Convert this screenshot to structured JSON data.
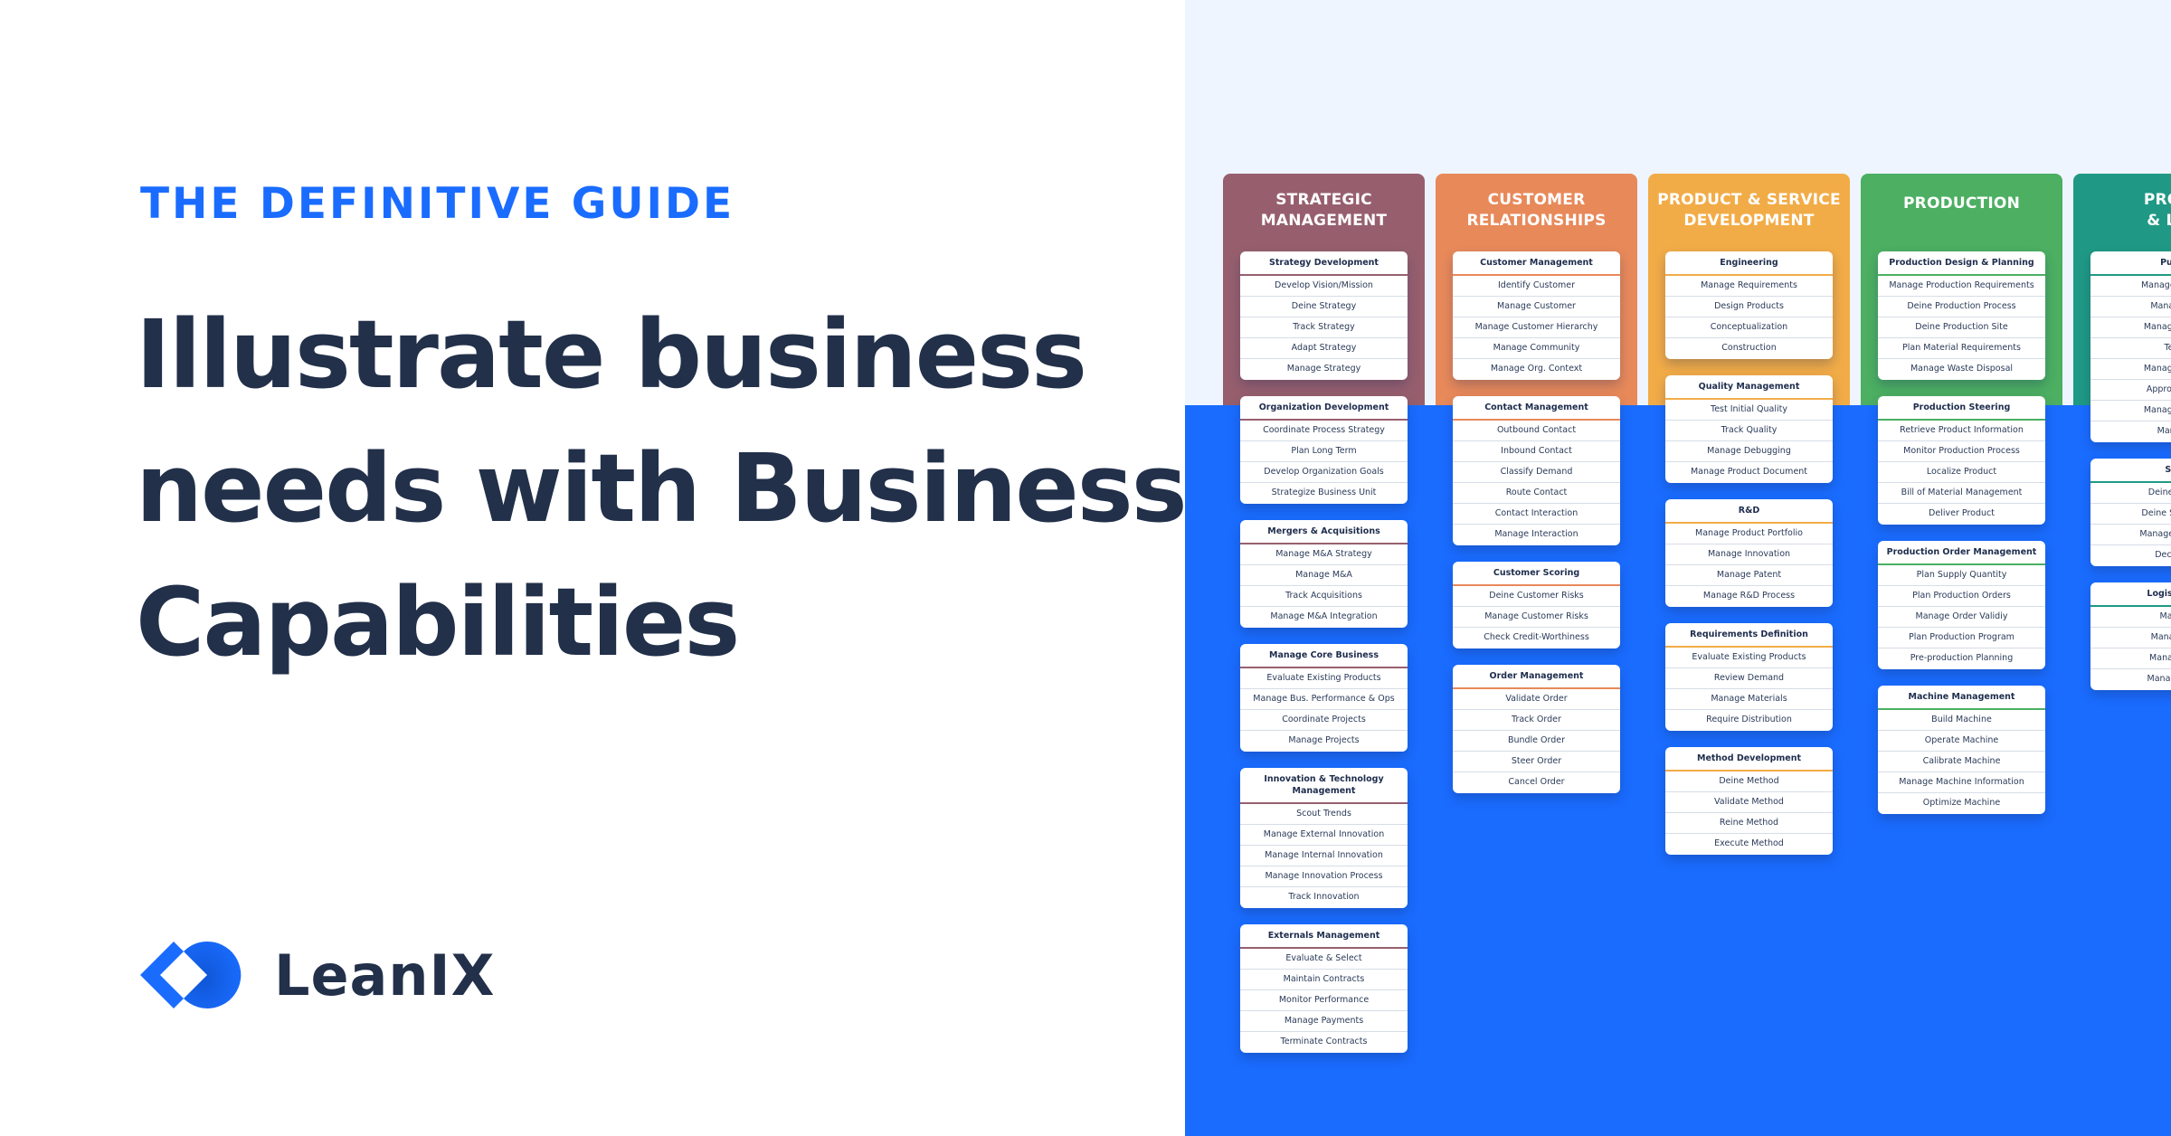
{
  "hero": {
    "eyebrow": "THE DEFINITIVE GUIDE",
    "headline_lines": [
      "Illustrate business",
      "needs with Business",
      "Capabilities"
    ]
  },
  "brand": {
    "name": "LeanIX",
    "logo_icon": "leanix-logo-icon",
    "color": "#1a6cff"
  },
  "colors": {
    "accent": "#1a6cff",
    "heading": "#22304a",
    "panel_background": "#eef5ff"
  },
  "capability_map": {
    "columns": [
      {
        "title_lines": [
          "STRATEGIC",
          "MANAGEMENT"
        ],
        "color": "#975f6e",
        "cards": [
          {
            "title": "Strategy Development",
            "items": [
              "Develop Vision/Mission",
              "Deine Strategy",
              "Track Strategy",
              "Adapt Strategy",
              "Manage Strategy"
            ]
          },
          {
            "title": "Organization Development",
            "items": [
              "Coordinate Process Strategy",
              "Plan Long Term",
              "Develop Organization Goals",
              "Strategize Business Unit"
            ]
          },
          {
            "title": "Mergers & Acquisitions",
            "items": [
              "Manage M&A Strategy",
              "Manage M&A",
              "Track Acquisitions",
              "Manage M&A Integration"
            ]
          },
          {
            "title": "Manage Core Business",
            "items": [
              "Evaluate Existing Products",
              "Manage Bus. Performance & Ops",
              "Coordinate Projects",
              "Manage Projects"
            ]
          },
          {
            "title": "Innovation & Technology Management",
            "items": [
              "Scout Trends",
              "Manage External Innovation",
              "Manage Internal Innovation",
              "Manage Innovation Process",
              "Track Innovation"
            ]
          },
          {
            "title": "Externals Management",
            "items": [
              "Evaluate & Select",
              "Maintain Contracts",
              "Monitor Performance",
              "Manage Payments",
              "Terminate Contracts"
            ]
          }
        ]
      },
      {
        "title_lines": [
          "CUSTOMER",
          "RELATIONSHIPS"
        ],
        "color": "#e8895a",
        "cards": [
          {
            "title": "Customer Management",
            "items": [
              "Identify Customer",
              "Manage Customer",
              "Manage Customer Hierarchy",
              "Manage Community",
              "Manage Org. Context"
            ]
          },
          {
            "title": "Contact Management",
            "items": [
              "Outbound Contact",
              "Inbound Contact",
              "Classify Demand",
              "Route Contact",
              "Contact Interaction",
              "Manage Interaction"
            ]
          },
          {
            "title": "Customer Scoring",
            "items": [
              "Deine Customer Risks",
              "Manage Customer Risks",
              "Check Credit-Worthiness"
            ]
          },
          {
            "title": "Order Management",
            "items": [
              "Validate Order",
              "Track Order",
              "Bundle Order",
              "Steer Order",
              "Cancel Order"
            ]
          }
        ]
      },
      {
        "title_lines": [
          "PRODUCT & SERVICE",
          "DEVELOPMENT"
        ],
        "color": "#f2ac47",
        "cards": [
          {
            "title": "Engineering",
            "items": [
              "Manage Requirements",
              "Design Products",
              "Conceptualization",
              "Construction"
            ]
          },
          {
            "title": "Quality Management",
            "items": [
              "Test Initial Quality",
              "Track Quality",
              "Manage Debugging",
              "Manage Product Document"
            ]
          },
          {
            "title": "R&D",
            "items": [
              "Manage Product Portfolio",
              "Manage Innovation",
              "Manage Patent",
              "Manage R&D Process"
            ]
          },
          {
            "title": "Requirements Definition",
            "items": [
              "Evaluate Existing Products",
              "Review Demand",
              "Manage Materials",
              "Require Distribution"
            ]
          },
          {
            "title": "Method Development",
            "items": [
              "Deine Method",
              "Validate Method",
              "Reine Method",
              "Execute Method"
            ]
          }
        ]
      },
      {
        "title_lines": [
          "PRODUCTION"
        ],
        "color": "#4caf62",
        "cards": [
          {
            "title": "Production Design & Planning",
            "items": [
              "Manage Production Requirements",
              "Deine Production Process",
              "Deine Production Site",
              "Plan Material Requirements",
              "Manage Waste Disposal"
            ]
          },
          {
            "title": "Production Steering",
            "items": [
              "Retrieve Product Information",
              "Monitor Production Process",
              "Localize Product",
              "Bill of Material Management",
              "Deliver Product"
            ]
          },
          {
            "title": "Production Order Management",
            "items": [
              "Plan Supply Quantity",
              "Plan Production Orders",
              "Manage Order Validiy",
              "Plan Production Program",
              "Pre-production Planning"
            ]
          },
          {
            "title": "Machine Management",
            "items": [
              "Build Machine",
              "Operate Machine",
              "Calibrate Machine",
              "Manage Machine Information",
              "Optimize Machine"
            ]
          }
        ]
      },
      {
        "title_lines": [
          "PROCU",
          "& LOG"
        ],
        "color": "#1f9985",
        "cards": [
          {
            "title": "Purch",
            "items": [
              "Manage Purcha",
              "Manage Pu",
              "Manage Purch",
              "Tend",
              "Manage Purch",
              "Approve & Tr",
              "Manage Purch",
              "Manage"
            ]
          },
          {
            "title": "Sou",
            "items": [
              "Deine Sourc",
              "Deine Sourcing",
              "Manage Sourcin",
              "Decide C"
            ]
          },
          {
            "title": "Logistics M",
            "items": [
              "Manag",
              "Manage Lo",
              "Manage Tra",
              "Manage Den"
            ]
          }
        ]
      }
    ]
  }
}
